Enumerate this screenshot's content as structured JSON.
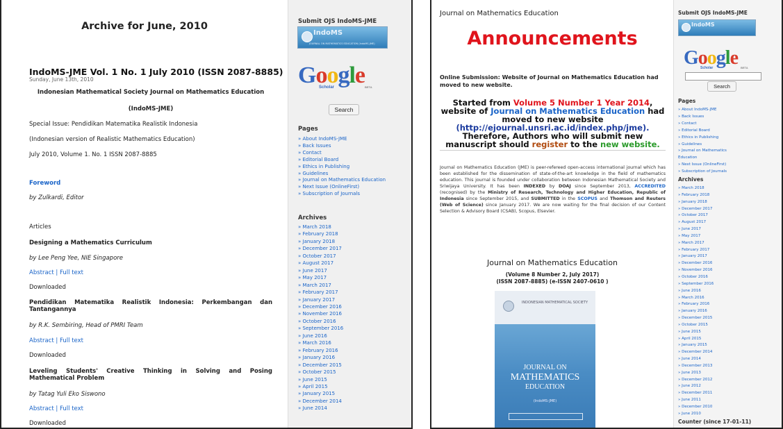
{
  "left": {
    "archive_title": "Archive for June, 2010",
    "post_title": "IndoMS-JME Vol. 1 No. 1 July 2010 (ISSN 2087-8885)",
    "post_date": "Sunday, June 13th, 2010",
    "journal_name_line1": "Indonesian Mathematical Society Journal on Mathematics Education",
    "journal_name_line2": "(IndoMS-JME)",
    "special_issue": "Special Issue: Pendidikan Matematika Realistik Indonesia",
    "indonesian_version": "(Indonesian version of Realistic Mathematics Education)",
    "volume_info": "July 2010, Volume 1. No. 1 ISSN 2087-8885",
    "foreword": "Foreword",
    "foreword_by": "by Zulkardi, Editor",
    "articles_heading": "Articles",
    "abstract_label": "Abstract",
    "separator": "|",
    "fulltext_label": "Full text",
    "downloaded_label": "Downloaded",
    "articles": [
      {
        "title": "Designing a Mathematics Curriculum",
        "author": "by Lee Peng Yee, NIE Singapore"
      },
      {
        "title_line1": "Pendidikan Matematika Realistik Indonesia: Perkembangan dan",
        "title_line2": "Tantangannya",
        "author": "by R.K. Sembiring, Head of PMRI Team"
      },
      {
        "title_line1": "Leveling Students' Creative Thinking in Solving and Posing",
        "title_line2": "Mathematical Problem",
        "author": "by Tatag Yuli Eko Siswono"
      }
    ],
    "sidebar": {
      "submit_title": "Submit OJS IndoMS-JME",
      "banner_name": "IndoMS",
      "banner_sub": "JOURNAL ON MATHEMATICS EDUCATION (IndoMS-JME)",
      "google_letters": [
        "G",
        "o",
        "o",
        "g",
        "l",
        "e"
      ],
      "google_colors": [
        "#3769c0",
        "#d93b2b",
        "#f1b712",
        "#3769c0",
        "#2e9a3c",
        "#d93b2b"
      ],
      "scholar_label": "Scholar",
      "beta_label": "BETA",
      "search_label": "Search",
      "pages_title": "Pages",
      "pages": [
        "» About IndoMS-JME",
        "» Back Issues",
        "» Contact",
        "» Editorial Board",
        "» Ethics in Publishing",
        "» Guidelines",
        "» Journal on Mathematics Education",
        "» Next Issue (OnlineFirst)",
        "» Subscription of Journals"
      ],
      "archives_title": "Archives",
      "archives": [
        "» March 2018",
        "» February 2018",
        "» January 2018",
        "» December 2017",
        "» October 2017",
        "» August 2017",
        "» June 2017",
        "» May 2017",
        "» March 2017",
        "» February 2017",
        "» January 2017",
        "» December 2016",
        "» November 2016",
        "» October 2016",
        "» September 2016",
        "» June 2016",
        "» March 2016",
        "» February 2016",
        "» January 2016",
        "» December 2015",
        "» October 2015",
        "» June 2015",
        "» April 2015",
        "» January 2015",
        "» December 2014",
        "» June 2014"
      ]
    }
  },
  "right": {
    "journal_title": "Journal on Mathematics Education",
    "announcements": "Announcements",
    "online_submission": "Online Submission: Website of Journal on Mathematics Education had moved to new website.",
    "started_from_prefix": "Started from ",
    "started_from_vol": "Volume 5 Number 1 Year 2014",
    "started_from_suffix": ",",
    "website_of": "website of ",
    "website_journal": "Journal on Mathematics Education",
    "had": " had",
    "moved_to": "moved to new website",
    "url": "(http://ejournal.unsri.ac.id/index.php/jme).",
    "therefore": "Therefore, Authors who will submit new",
    "manuscript_prefix": "manuscript should ",
    "register": "register",
    "to_the": " to the ",
    "new_website": "new website.",
    "para_1": "Journal on Mathematics Education (JME) is peer-refereed open-access international journal which has been established for the dissemination of state-of-the-art knowledge in the field of mathematics education. This journal is founded under collaboration between Indonesian Mathematical Society and Sriwijaya University. It has been ",
    "indexed": "INDEXED",
    "by": " by ",
    "doaj": "DOAJ",
    "para_2": " since September 2013, ",
    "accredited": "ACCREDITED",
    "para_3": " (recognised) by the ",
    "ministry": "Ministry of Research, Technology and Higher Education, Republic of Indonesia",
    "para_4": " since September 2015, and ",
    "submitted": "SUBMITTED",
    "para_5": " in the ",
    "scopus": "SCOPUS",
    "and": " and ",
    "thomson": "Thomson and Reuters (Web of Science)",
    "para_6": " since January 2017. We are now waiting for the final decision of our Content Selection & Advisory Board (CSAB), Scopus, Elsevier.",
    "jme_heading": "Journal on Mathematics Education",
    "vol_line": "(Volume 8 Number 2, July 2017)",
    "issn_line": "(ISSN 2087-8885) (e-ISSN 2407-0610 )",
    "cover_society": "INDONESIAN MATHEMATICAL SOCIETY",
    "cover_journal_on": "JOURNAL ON",
    "cover_mathematics": "MATHEMATICS",
    "cover_education": "EDUCATION",
    "cover_abbr": "(IndoMS-JME)",
    "sidebar": {
      "submit_title": "Submit OJS IndoMS-JME",
      "banner_name": "IndoMS",
      "scholar_label": "Scholar",
      "beta_label": "BETA",
      "search_label": "Search",
      "pages_title": "Pages",
      "pages": [
        "» About IndoMS-JME",
        "» Back Issues",
        "» Contact",
        "» Editorial Board",
        "» Ethics in Publishing",
        "» Guidelines",
        "» Journal on Mathematics",
        "Education",
        "» Next Issue (OnlineFirst)",
        "» Subscription of Journals"
      ],
      "archives_title": "Archives",
      "archives": [
        "» March 2018",
        "» February 2018",
        "» January 2018",
        "» December 2017",
        "» October 2017",
        "» August 2017",
        "» June 2017",
        "» May 2017",
        "» March 2017",
        "» February 2017",
        "» January 2017",
        "» December 2016",
        "» November 2016",
        "» October 2016",
        "» September 2016",
        "» June 2016",
        "» March 2016",
        "» February 2016",
        "» January 2016",
        "» December 2015",
        "» October 2015",
        "» June 2015",
        "» April 2015",
        "» January 2015",
        "» December 2014",
        "» June 2014",
        "» December 2013",
        "» June 2013",
        "» December 2012",
        "» June 2012",
        "» December 2011",
        "» June 2011",
        "» December 2010",
        "» June 2010"
      ],
      "counter_title": "Counter (since 17-01-11)"
    }
  }
}
